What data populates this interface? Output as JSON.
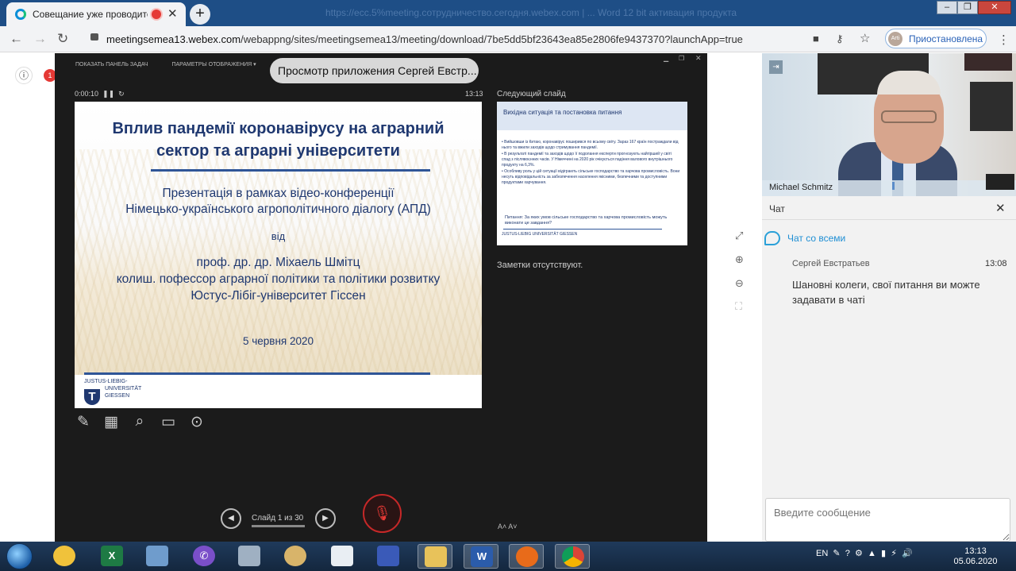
{
  "browser": {
    "tab_title": "Совещание уже проводится",
    "new_tab": "+",
    "blurred_title": "https://ecc.5%meeting.сотрудничество.сегодня.webex.com | ... Word 12 bit активация продукта",
    "win_min": "–",
    "win_restore": "❐",
    "win_close": "✕",
    "url_host": "meetingsemea13.webex.com",
    "url_path": "/webappng/sites/meetingsemea13/meeting/download/7be5dd5bf23643ea85e2806fe9437370?launchApp=true",
    "profile_initials": "Arti",
    "profile_status": "Приостановлена",
    "badge_count": "1"
  },
  "presenter": {
    "show_taskbar": "ПОКАЗАТЬ ПАНЕЛЬ ЗАДАЧ",
    "display_settings": "ПАРАМЕТРЫ ОТОБРАЖЕНИЯ ▾",
    "tooltip": "Просмотр приложения Сергей Евстр...",
    "elapsed": "0:00:10",
    "clock": "13:13",
    "next_label": "Следующий слайд",
    "notes": "Заметки отсутствуют.",
    "slide_counter": "Слайд 1 из 30",
    "font_buttons": "A˄  A˅"
  },
  "slide": {
    "title_line1": "Вплив пандемії коронавірусу на аграрний",
    "title_line2": "сектор та аграрні університети",
    "sub_line1": "Презентація в рамках відео-конференції",
    "sub_line2": "Німецько-українського агрополітичного діалогу (АПД)",
    "from": "від",
    "author_line1": "проф. др. др. Міхаель Шмітц",
    "author_line2": "колиш. пофессор аграрної політики та політики розвитку",
    "author_line3": "Юстус-Лібіг-університет Гіссен",
    "date": "5 червня 2020",
    "logo_line1": "JUSTUS-LIEBIG-",
    "logo_line2": "UNIVERSITÄT",
    "logo_line3": "GIESSEN",
    "logo_mark": "T"
  },
  "next_slide": {
    "heading": "Вихідна ситуація та постановка питання",
    "b1": "• Вийшовши із Китаю, коронавірус поширився по всьому світу. Зараз 167 країн постраждали від нього та вжили заходів щодо стримування пандемії.",
    "b2": "• В результаті пандемії та заходів щодо її подолання експерти прогнозують найгірший у світі спад з післявоєнних часів. У Німеччині на 2020 рік очікується падіння валового внутрішнього продукту на 6,3%.",
    "b3": "• Особливу роль у цій ситуації відіграють сільське господарство та харчова промисловість. Вони несуть відповідальність за забезпечення населення якісними, безпечними та доступними продуктами харчування.",
    "question": "Питання: За яких умов сільське господарство та харчова промисловість можуть виконати це завдання?",
    "logo": "JUSTUS-LIEBIG UNIVERSITÄT GIESSEN"
  },
  "video": {
    "participant": "Michael Schmitz"
  },
  "chat": {
    "title": "Чат",
    "channel": "Чат со всеми",
    "msg_sender": "Сергей Евстратьев",
    "msg_time": "13:08",
    "msg_text": "Шановні колеги, свої питання ви можте задавати в чаті",
    "input_placeholder": "Введите сообщение"
  },
  "taskbar": {
    "lang": "EN",
    "time": "13:13",
    "date": "05.06.2020"
  },
  "colors": {
    "tabbar": "#1e4e86",
    "slide_text": "#1f3870",
    "chat_accent": "#1f8fd4",
    "mute_red": "#c62828"
  }
}
